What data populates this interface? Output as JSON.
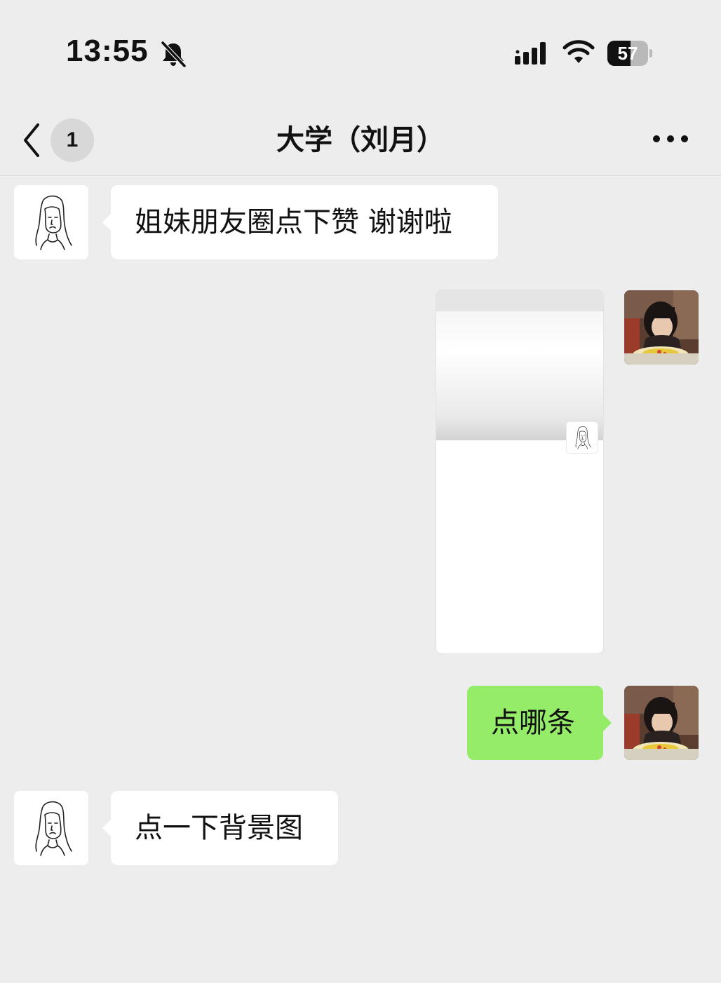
{
  "status_bar": {
    "time": "13:55",
    "battery_level": "57",
    "icons": [
      "bell-slash-icon",
      "signal-icon",
      "wifi-icon",
      "battery-icon"
    ]
  },
  "nav": {
    "back_icon": "chevron-left-icon",
    "unread_count": "1",
    "title": "大学（刘月）",
    "more_icon": "more-dots-icon"
  },
  "messages": [
    {
      "sender": "other",
      "type": "text",
      "text": "姐妹朋友圈点下赞 谢谢啦",
      "avatar": "sketch-girl-avatar"
    },
    {
      "sender": "me",
      "type": "image",
      "avatar": "photo-girl-avatar"
    },
    {
      "sender": "me",
      "type": "text",
      "text": "点哪条",
      "avatar": "photo-girl-avatar"
    },
    {
      "sender": "other",
      "type": "text",
      "text": "点一下背景图",
      "avatar": "sketch-girl-avatar"
    }
  ],
  "colors": {
    "background": "#ededed",
    "bubble_other": "#ffffff",
    "bubble_me": "#95ec69",
    "badge": "#d8d8d8"
  }
}
